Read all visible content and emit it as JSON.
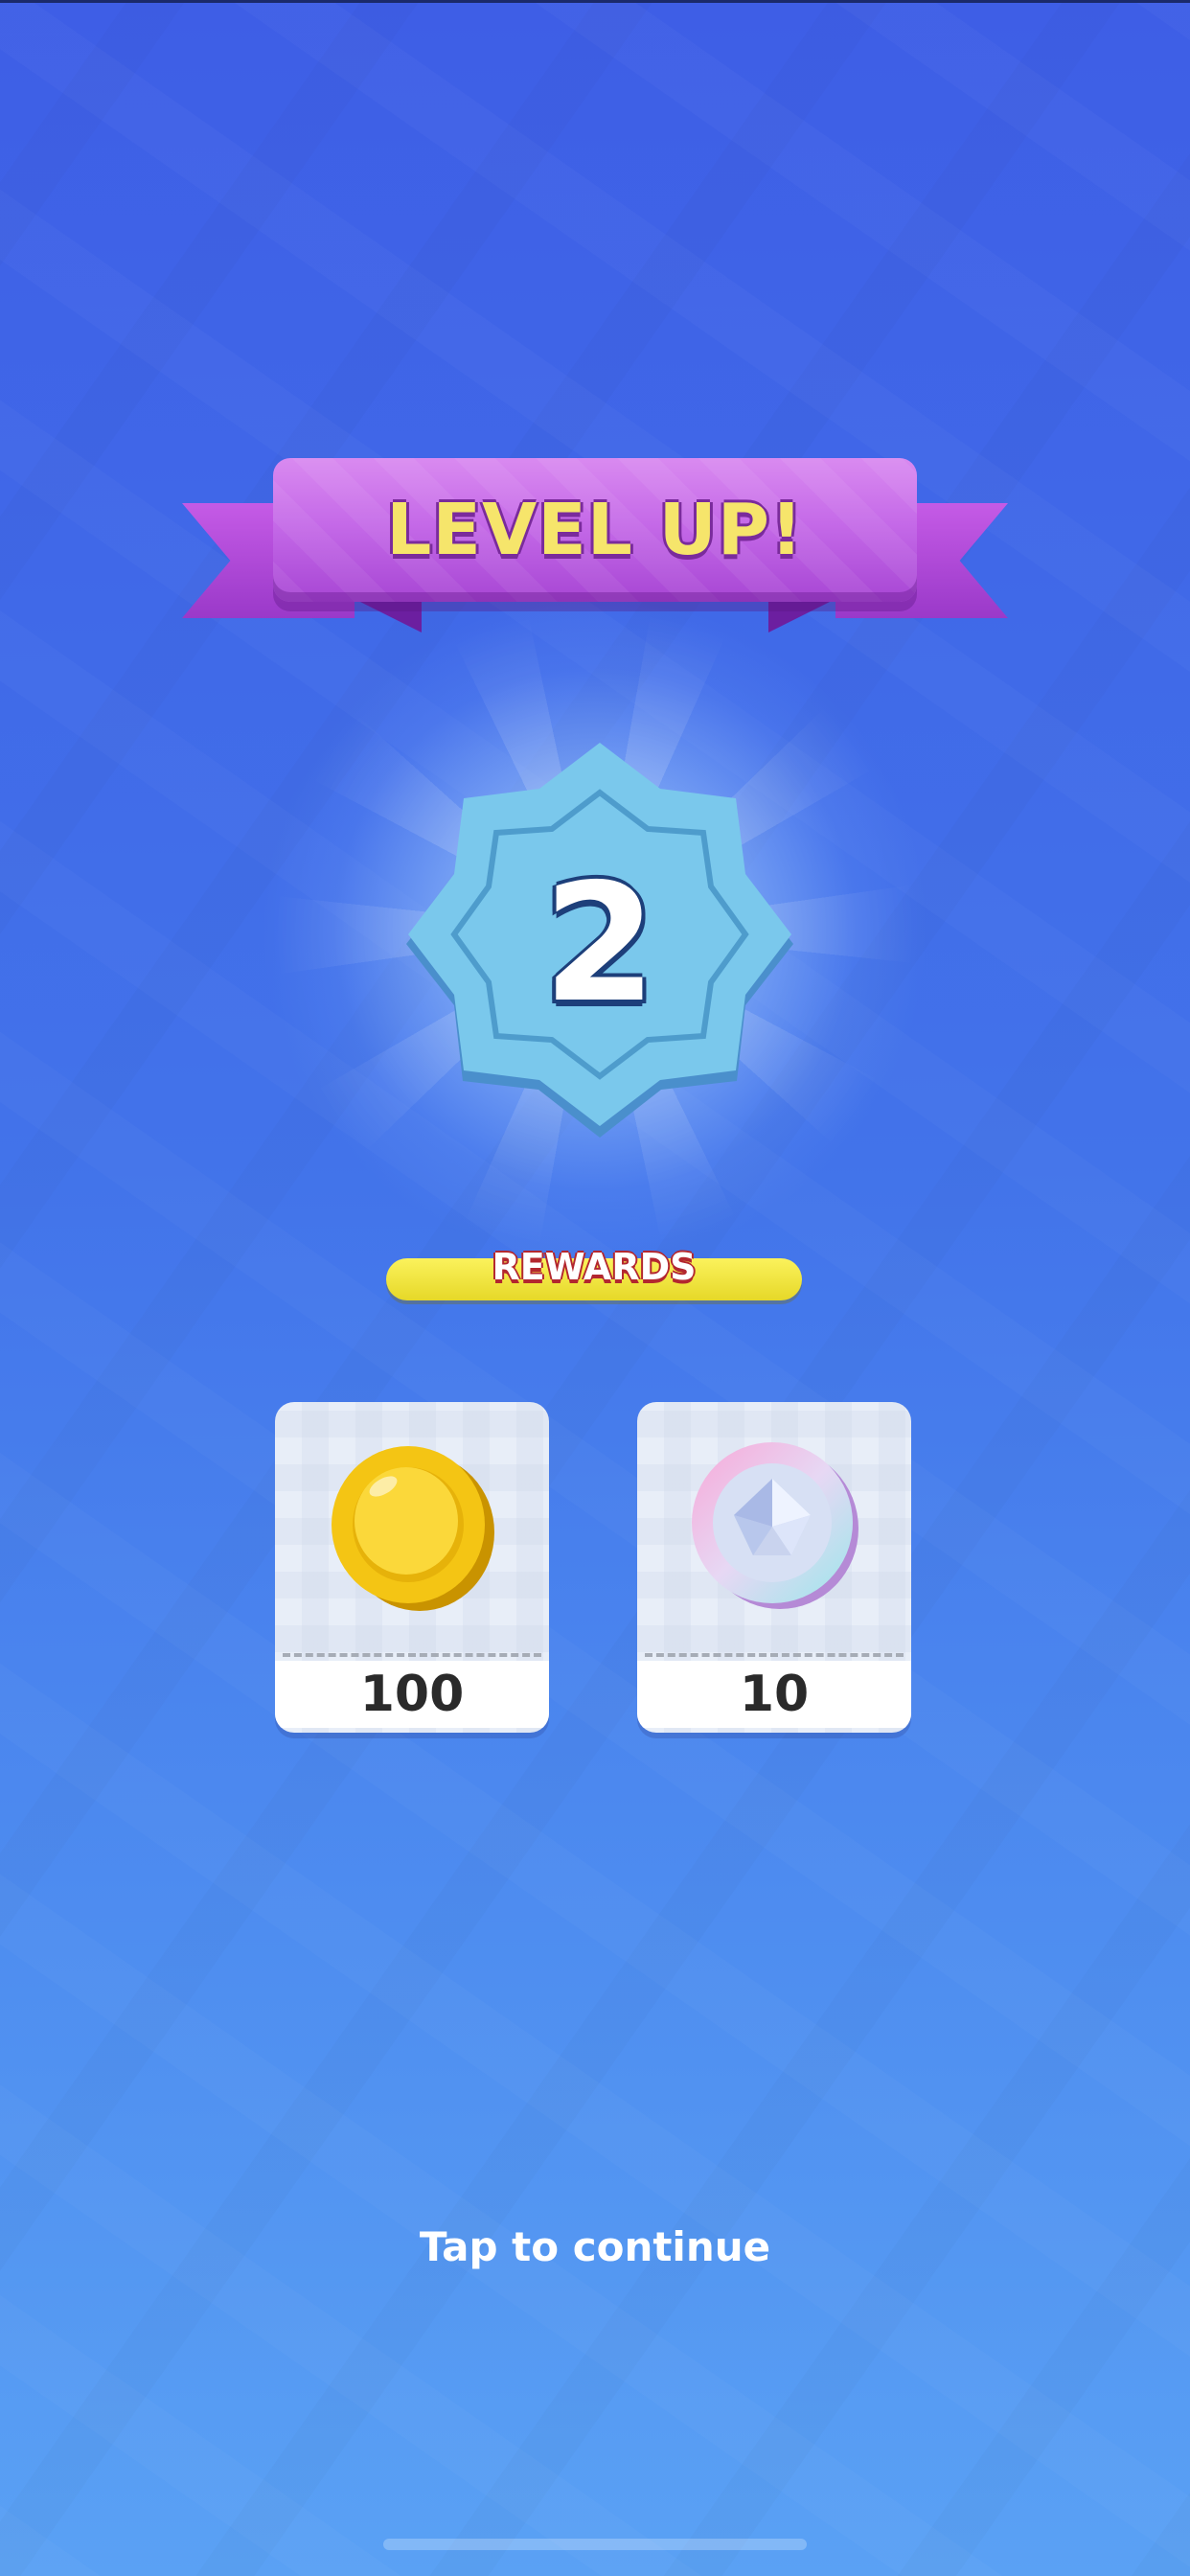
{
  "banner": {
    "title": "LEVEL UP!"
  },
  "level": {
    "value": "2"
  },
  "rewards": {
    "label": "REWARDS",
    "items": [
      {
        "icon": "gold-coin-icon",
        "amount": "100"
      },
      {
        "icon": "pink-gem-coin-icon",
        "amount": "10"
      }
    ]
  },
  "footer": {
    "continue_label": "Tap to continue"
  },
  "colors": {
    "background_top": "#3e5ee6",
    "background_bottom": "#5aa1f4",
    "ribbon": "#c56ae8",
    "ribbon_text": "#f6e56b",
    "badge": "#79c9ec",
    "rewards_bar": "#fbf25c"
  }
}
